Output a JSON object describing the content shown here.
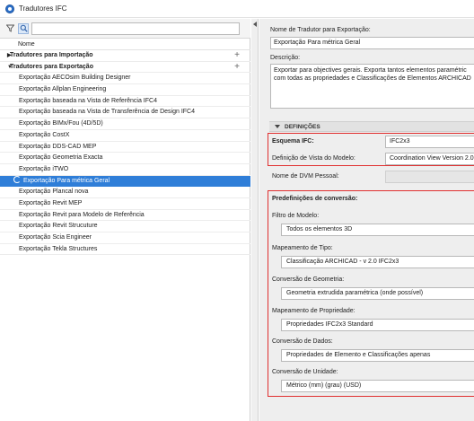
{
  "window": {
    "title": "Tradutores IFC"
  },
  "search": {
    "placeholder": "",
    "value": ""
  },
  "list": {
    "header": "Nome",
    "groups": [
      {
        "label": "Tradutores para Importação",
        "expanded": false
      },
      {
        "label": "Tradutores para Exportação",
        "expanded": true
      }
    ],
    "items": [
      "Exportação AECOsim Building Designer",
      "Exportação Allplan Engineering",
      "Exportação baseada na Vista de Referência IFC4",
      "Exportação baseada na Vista de Transferência de Design IFC4",
      "Exportação BIMx/Fou (4D/5D)",
      "Exportação CostX",
      "Exportação DDS-CAD MEP",
      "Exportação Geometria Exacta",
      "Exportação iTWO",
      "Exportação Para métrica Geral",
      "Exportação Plancal nova",
      "Exportação Revit MEP",
      "Exportação Revit para Modelo de Referência",
      "Exportação Revit Strucuture",
      "Exportação Scia Engineer",
      "Exportação Tekla Structures"
    ],
    "selected_index": 9,
    "plus_symbol": "+"
  },
  "details": {
    "name_label": "Nome de Tradutor para Exportação:",
    "name_value": "Exportação Para métrica Geral",
    "desc_label": "Descrição:",
    "desc_line1": "Exportar para objectives gerais. Exporta tantos elementos paramétric",
    "desc_line2": "com todas as propriedades e Classificações de Elementos ARCHICAD",
    "section_title": "DEFINIÇÕES",
    "schema_label": "Esquema IFC:",
    "schema_value": "IFC2x3",
    "mvd_label": "Definição de Vista do Modelo:",
    "mvd_value": "Coordination View Version 2.0",
    "dvm_label": "Nome de DVM Pessoal:",
    "dvm_value": "",
    "presets_title": "Predefinições de conversão:",
    "presets": [
      {
        "label": "Filtro de Modelo:",
        "value": "Todos os elementos 3D"
      },
      {
        "label": "Mapeamento de Tipo:",
        "value": "Classificação ARCHICAD - v 2.0 IFC2x3"
      },
      {
        "label": "Conversão de Geometria:",
        "value": "Geometria extrudida paramétrica (onde possível)"
      },
      {
        "label": "Mapeamento de Propriedade:",
        "value": "Propriedades IFC2x3 Standard"
      },
      {
        "label": "Conversão de Dados:",
        "value": "Propriedades de Elemento e Classificações apenas"
      },
      {
        "label": "Conversão de Unidade:",
        "value": "Métrico (mm) (grau) (USD)"
      }
    ]
  },
  "colors": {
    "selection": "#2f7ed8",
    "highlight_box": "#e03030",
    "accent_icon": "#2a6fc9"
  }
}
